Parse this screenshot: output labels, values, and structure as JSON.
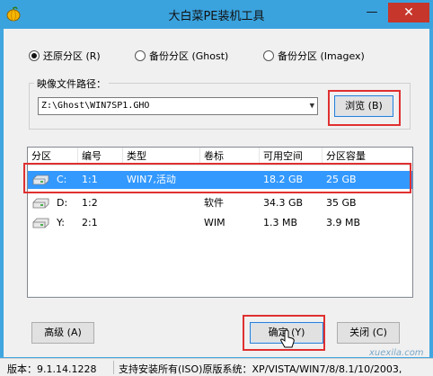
{
  "window": {
    "title": "大白菜PE装机工具",
    "minimize_glyph": "—",
    "close_glyph": "✕",
    "icon": "pumpkin-app-icon"
  },
  "mode_options": [
    {
      "label": "还原分区 (R)",
      "selected": true
    },
    {
      "label": "备份分区 (Ghost)",
      "selected": false
    },
    {
      "label": "备份分区 (Imagex)",
      "selected": false
    }
  ],
  "image_path": {
    "label": "映像文件路径：",
    "value": "Z:\\Ghost\\WIN7SP1.GHO",
    "browse_label": "浏览 (B)"
  },
  "partition_table": {
    "columns": [
      "分区",
      "编号",
      "类型",
      "卷标",
      "可用空间",
      "分区容量"
    ],
    "rows": [
      {
        "drive": "C:",
        "number": "1:1",
        "type": "WIN7,活动",
        "label": "",
        "free": "18.2 GB",
        "size": "25 GB",
        "selected": true
      },
      {
        "drive": "D:",
        "number": "1:2",
        "type": "",
        "label": "软件",
        "free": "34.3 GB",
        "size": "35 GB",
        "selected": false
      },
      {
        "drive": "Y:",
        "number": "2:1",
        "type": "",
        "label": "WIM",
        "free": "1.3 MB",
        "size": "3.9 MB",
        "selected": false
      }
    ]
  },
  "buttons": {
    "advanced": "高级 (A)",
    "ok": "确定 (Y)",
    "close": "关闭 (C)"
  },
  "status_bar": {
    "version": "版本：9.1.14.1228",
    "support": "支持安装所有(ISO)原版系统：XP/VISTA/WIN7/8/8.1/10/2003,"
  },
  "watermark": "xuexila.com",
  "colors": {
    "title_bar": "#3aa3de",
    "selection": "#3399ff",
    "highlight_box": "#e03030"
  }
}
